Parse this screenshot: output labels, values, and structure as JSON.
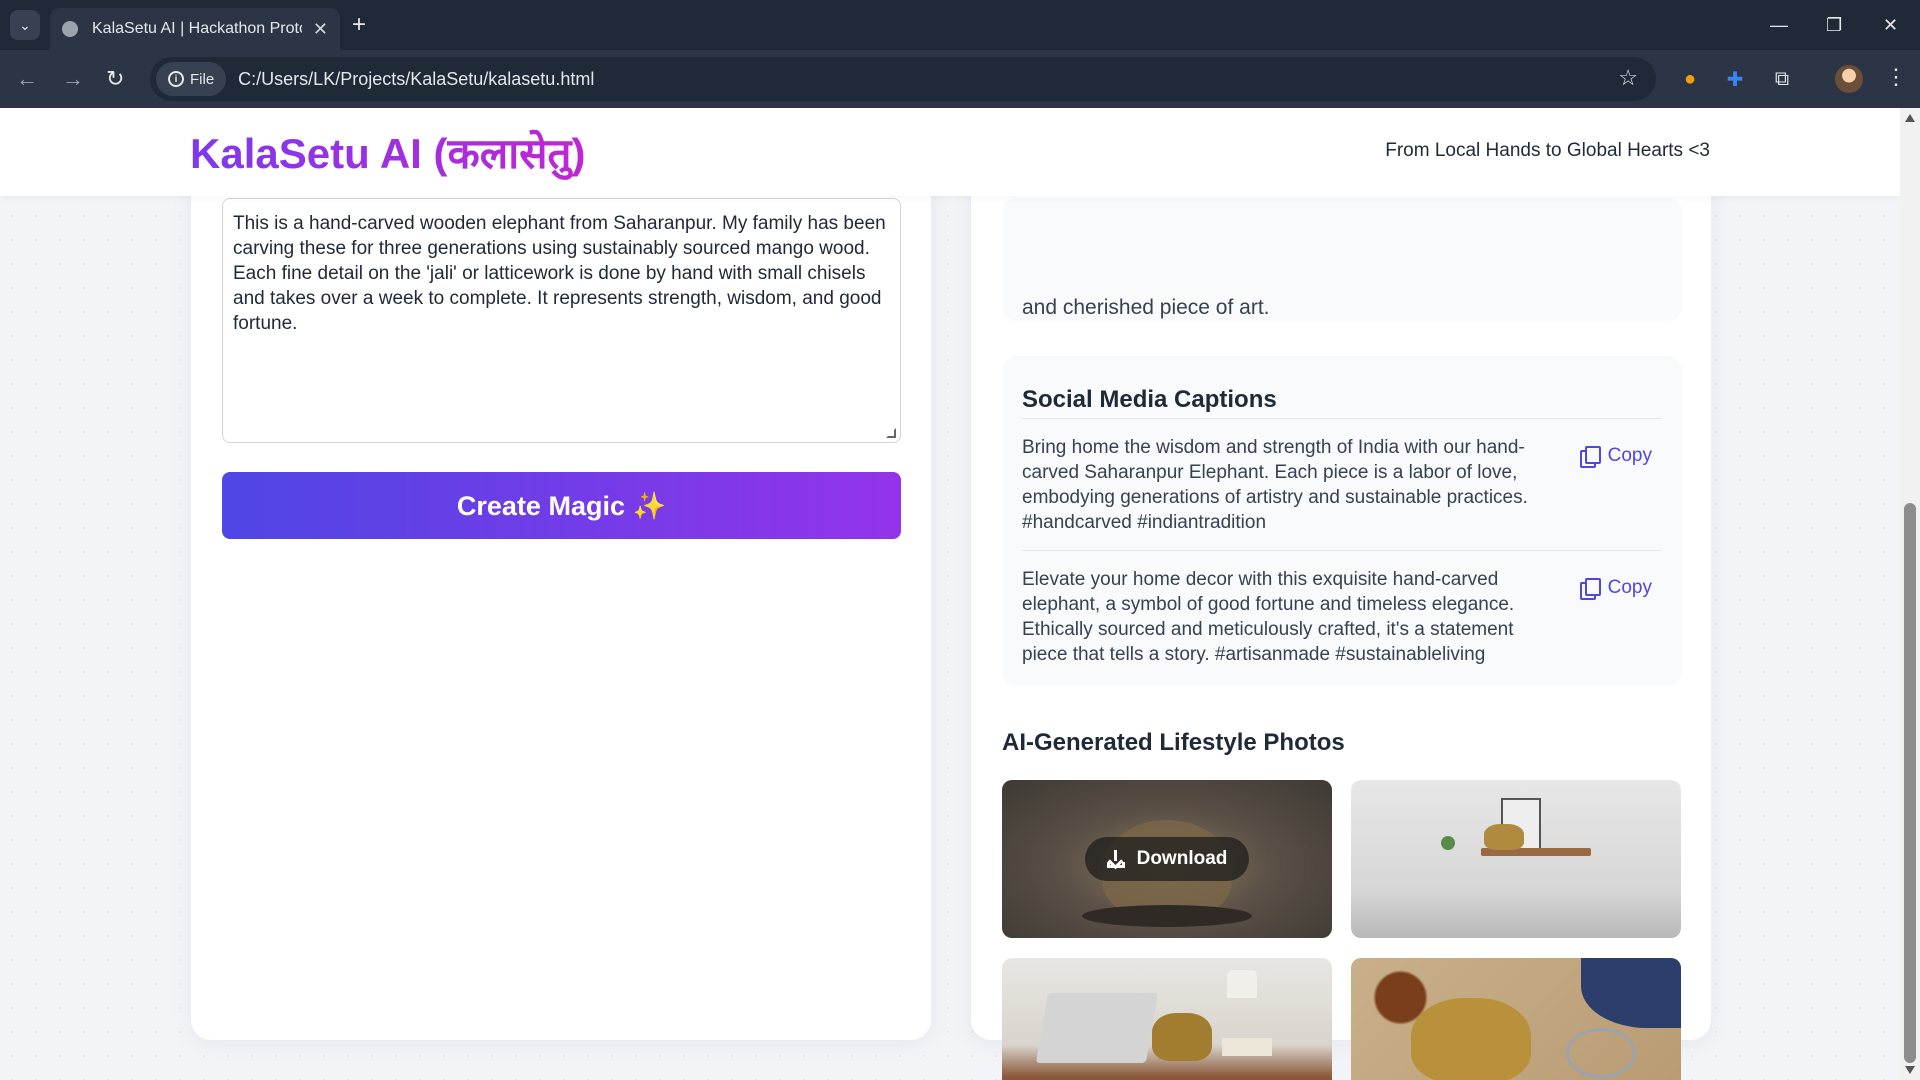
{
  "browser": {
    "tab_title": "KalaSetu AI | Hackathon Prototy",
    "tab_close": "✕",
    "new_tab": "+",
    "file_chip": "File",
    "url": "C:/Users/LK/Projects/KalaSetu/kalasetu.html"
  },
  "header": {
    "logo": "KalaSetu AI (कलासेतु)",
    "tagline": "From Local Hands to Global Hearts <3"
  },
  "form": {
    "story_text": "This is a hand-carved wooden elephant from Saharanpur. My family has been carving these for three generations using sustainably sourced mango wood. Each fine detail on the 'jali' or latticework is done by hand with small chisels and takes over a week to complete. It represents strength, wisdom, and good fortune.",
    "button_label": "Create Magic ✨"
  },
  "results": {
    "previous_tail": "and cherished piece of art.",
    "captions_title": "Social Media Captions",
    "copy_label": "Copy",
    "captions": [
      "Bring home the wisdom and strength of India with our hand-carved Saharanpur Elephant. Each piece is a labor of love, embodying generations of artistry and sustainable practices. #handcarved #indiantradition",
      "Elevate your home decor with this exquisite hand-carved elephant, a symbol of good fortune and timeless elegance. Ethically sourced and meticulously crafted, it's a statement piece that tells a story. #artisanmade #sustainableliving"
    ],
    "photos_title": "AI-Generated Lifestyle Photos",
    "download_label": "Download"
  },
  "colors": {
    "accent": "#4f46e5",
    "accent_end": "#9333ea",
    "logo_start": "#7c3aed",
    "logo_end": "#c026d3"
  }
}
